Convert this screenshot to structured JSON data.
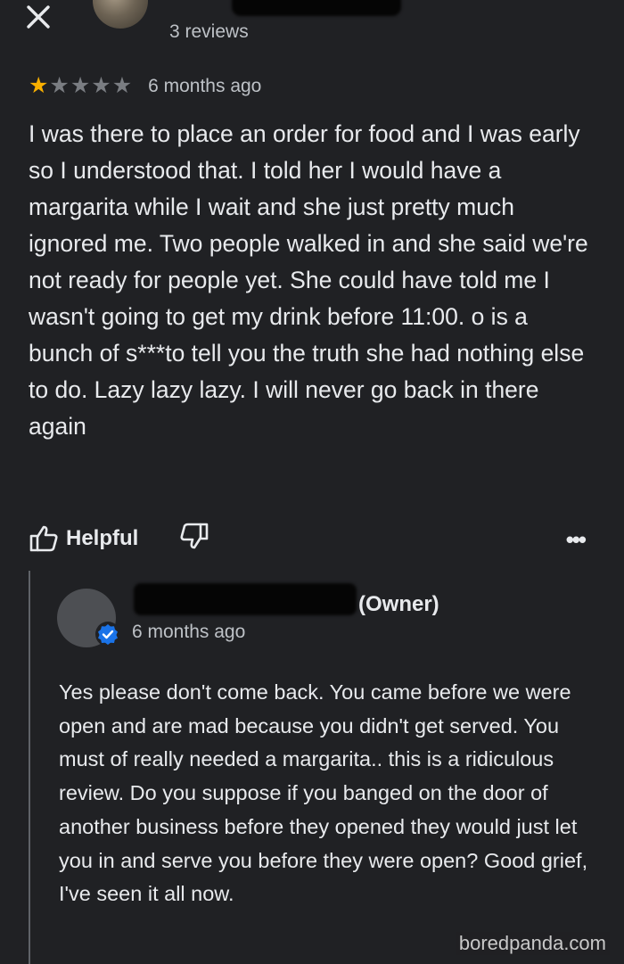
{
  "header": {
    "reviews_count": "3 reviews",
    "close_icon": "close-icon"
  },
  "review": {
    "rating": 1,
    "max_rating": 5,
    "date": "6 months ago",
    "text": "I was there to place an order for food and I was early so I understood that. I told her I would have a margarita while I wait and she just pretty much ignored me. Two people walked in and she said we're not ready for people yet. She could have told me I wasn't going to get my drink before 11:00. o is a bunch of s***to tell you the truth she had nothing else to do. Lazy lazy lazy. I will never go back in there again",
    "star_color": "#f9b000"
  },
  "actions": {
    "helpful_label": "Helpful",
    "helpful_icon": "thumbs-up-icon",
    "unhelpful_icon": "thumbs-down-icon",
    "more_label": "•••"
  },
  "owner_response": {
    "owner_tag": "(Owner)",
    "date": "6 months ago",
    "verified_icon": "verified-check-icon",
    "text": "Yes please don't come back. You came before we were open and are mad because you didn't get served. You must of really needed a margarita.. this is a ridiculous review. Do you suppose if you banged on the door of another business before they opened they would just let you in and serve you before they were open? Good grief, I've seen it all now.",
    "badge_color": "#1a73e8"
  },
  "watermark": "boredpanda.com"
}
